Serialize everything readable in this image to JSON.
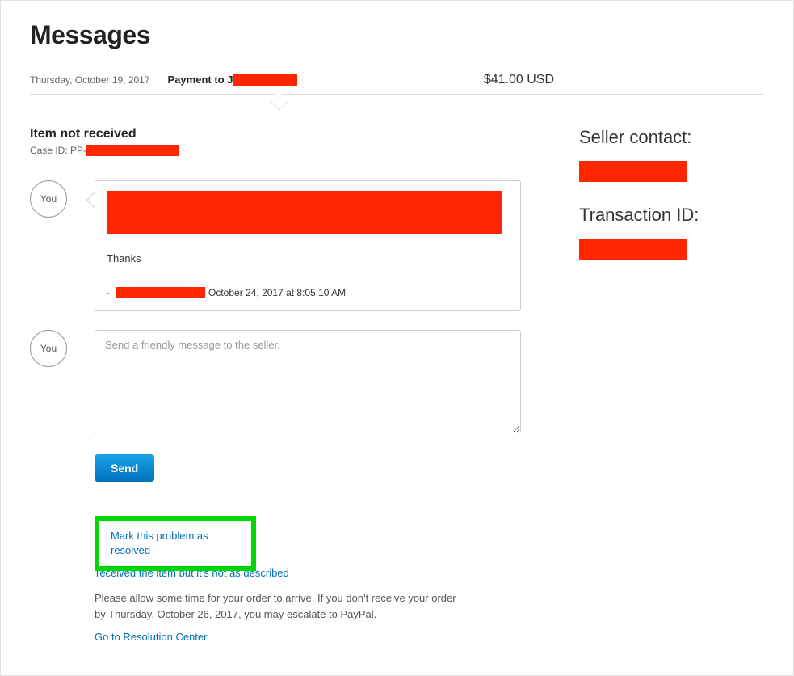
{
  "page_title": "Messages",
  "header": {
    "date": "Thursday, October 19, 2017",
    "payment_label": "Payment to J",
    "amount": "$41.00 USD"
  },
  "case": {
    "title": "Item not received",
    "id_label": "Case ID: PP-"
  },
  "thread": {
    "avatar_label": "You",
    "message": {
      "thanks": "Thanks",
      "meta_dash": "-",
      "timestamp": "October 24, 2017 at 8:05:10 AM"
    }
  },
  "compose": {
    "avatar_label": "You",
    "placeholder": "Send a friendly message to the seller.",
    "send_label": "Send"
  },
  "actions": {
    "resolve_link": "Mark this problem as resolved",
    "snad_link": "received the item but it's not as described",
    "info": "Please allow some time for your order to arrive. If you don't receive your order by Thursday, October 26, 2017, you may escalate to PayPal.",
    "resolution_center_link": "Go to Resolution Center"
  },
  "sidebar": {
    "seller_contact_label": "Seller contact:",
    "transaction_id_label": "Transaction ID:"
  }
}
